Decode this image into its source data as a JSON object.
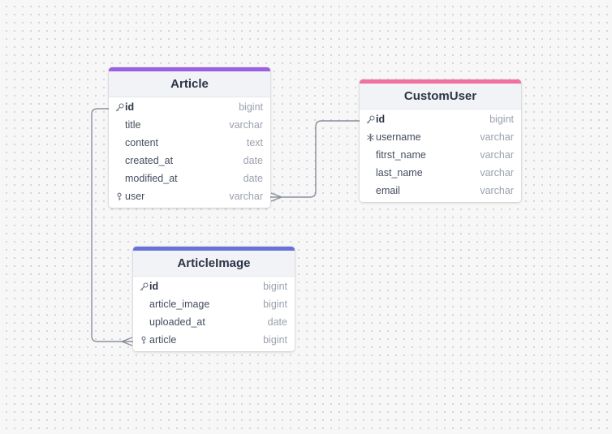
{
  "tables": [
    {
      "id": "article",
      "name": "Article",
      "accent": "#9b5fe0",
      "fields": [
        {
          "name": "id",
          "type": "bigint",
          "icon": "key-icon",
          "pk": true
        },
        {
          "name": "title",
          "type": "varchar",
          "icon": "",
          "pk": false
        },
        {
          "name": "content",
          "type": "text",
          "icon": "",
          "pk": false
        },
        {
          "name": "created_at",
          "type": "date",
          "icon": "",
          "pk": false
        },
        {
          "name": "modified_at",
          "type": "date",
          "icon": "",
          "pk": false
        },
        {
          "name": "user",
          "type": "varchar",
          "icon": "foreign-key-icon",
          "pk": false
        }
      ]
    },
    {
      "id": "customuser",
      "name": "CustomUser",
      "accent": "#f0709f",
      "fields": [
        {
          "name": "id",
          "type": "bigint",
          "icon": "key-icon",
          "pk": true
        },
        {
          "name": "username",
          "type": "varchar",
          "icon": "unique-icon",
          "pk": false
        },
        {
          "name": "fitrst_name",
          "type": "varchar",
          "icon": "",
          "pk": false
        },
        {
          "name": "last_name",
          "type": "varchar",
          "icon": "",
          "pk": false
        },
        {
          "name": "email",
          "type": "varchar",
          "icon": "",
          "pk": false
        }
      ]
    },
    {
      "id": "articleimage",
      "name": "ArticleImage",
      "accent": "#6672d8",
      "fields": [
        {
          "name": "id",
          "type": "bigint",
          "icon": "key-icon",
          "pk": true
        },
        {
          "name": "article_image",
          "type": "bigint",
          "icon": "",
          "pk": false
        },
        {
          "name": "uploaded_at",
          "type": "date",
          "icon": "",
          "pk": false
        },
        {
          "name": "article",
          "type": "bigint",
          "icon": "foreign-key-icon",
          "pk": false
        }
      ]
    }
  ],
  "relations": [
    {
      "from_table": "customuser",
      "from_field": "id",
      "to_table": "article",
      "to_field": "user",
      "cardinality": "one-to-many"
    },
    {
      "from_table": "article",
      "from_field": "id",
      "to_table": "articleimage",
      "to_field": "article",
      "cardinality": "one-to-many"
    }
  ],
  "colors": {
    "line": "#8a8f99",
    "header_bg": "#f1f3f7"
  }
}
